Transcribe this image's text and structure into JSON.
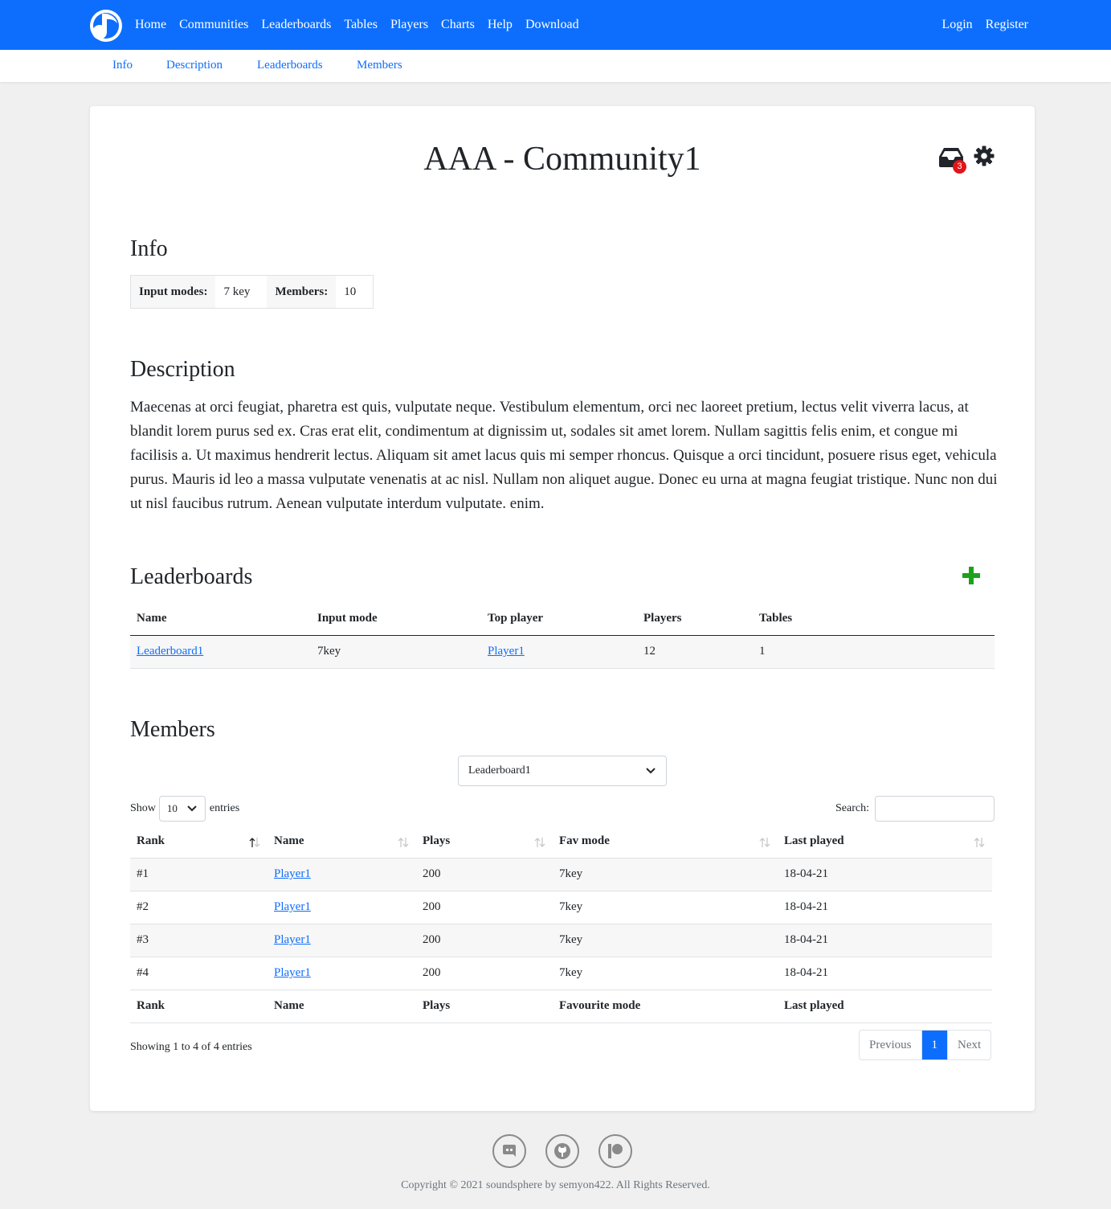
{
  "navbar": {
    "links": [
      "Home",
      "Communities",
      "Leaderboards",
      "Tables",
      "Players",
      "Charts",
      "Help",
      "Download"
    ],
    "login": "Login",
    "register": "Register"
  },
  "subnav": {
    "links": [
      "Info",
      "Description",
      "Leaderboards",
      "Members"
    ]
  },
  "page": {
    "title": "AAA - Community1",
    "inbox_count": "3"
  },
  "info": {
    "heading": "Info",
    "input_modes_label": "Input modes:",
    "input_modes_value": "7 key",
    "members_label": "Members:",
    "members_value": "10"
  },
  "description": {
    "heading": "Description",
    "text": "Maecenas at orci feugiat, pharetra est quis, vulputate neque. Vestibulum elementum, orci nec laoreet pretium, lectus velit viverra lacus, at blandit lorem purus sed ex. Cras erat elit, condimentum at dignissim ut, sodales sit amet lorem. Nullam sagittis felis enim, et congue mi facilisis a. Ut maximus hendrerit lectus. Aliquam sit amet lacus quis mi semper rhoncus. Quisque a orci tincidunt, posuere risus eget, vehicula purus. Mauris id leo a massa vulputate venenatis at ac nisl. Nullam non aliquet augue. Donec eu urna at magna feugiat tristique. Nunc non dui ut nisl faucibus rutrum. Aenean vulputate interdum vulputate. enim."
  },
  "leaderboards": {
    "heading": "Leaderboards",
    "columns": [
      "Name",
      "Input mode",
      "Top player",
      "Players",
      "Tables"
    ],
    "rows": [
      {
        "name": "Leaderboard1",
        "input_mode": "7key",
        "top_player": "Player1",
        "players": "12",
        "tables": "1"
      }
    ]
  },
  "members": {
    "heading": "Members",
    "leaderboard_select": "Leaderboard1",
    "show_label": "Show",
    "show_value": "10",
    "entries_label": "entries",
    "search_label": "Search:",
    "columns": [
      "Rank",
      "Name",
      "Plays",
      "Fav mode",
      "Last played"
    ],
    "footer_columns": [
      "Rank",
      "Name",
      "Plays",
      "Favourite mode",
      "Last played"
    ],
    "rows": [
      {
        "rank": "#1",
        "name": "Player1",
        "plays": "200",
        "fav_mode": "7key",
        "last_played": "18-04-21"
      },
      {
        "rank": "#2",
        "name": "Player1",
        "plays": "200",
        "fav_mode": "7key",
        "last_played": "18-04-21"
      },
      {
        "rank": "#3",
        "name": "Player1",
        "plays": "200",
        "fav_mode": "7key",
        "last_played": "18-04-21"
      },
      {
        "rank": "#4",
        "name": "Player1",
        "plays": "200",
        "fav_mode": "7key",
        "last_played": "18-04-21"
      }
    ],
    "showing_text": "Showing 1 to 4 of 4 entries",
    "pager": {
      "previous": "Previous",
      "current": "1",
      "next": "Next"
    }
  },
  "footer": {
    "icons": [
      "discord-icon",
      "github-icon",
      "patreon-icon"
    ],
    "copyright": "Copyright © 2021 soundsphere by semyon422. All Rights Reserved."
  },
  "colors": {
    "primary": "#0d6efd",
    "add_green": "#1aa31a",
    "badge_red": "#e0151b"
  }
}
